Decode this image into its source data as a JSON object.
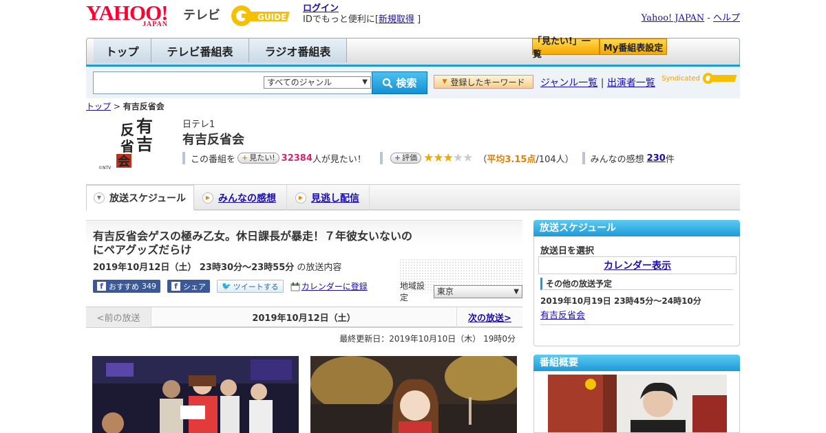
{
  "header": {
    "yahoo_logo": "YAHOO!",
    "yahoo_logo_sub": "JAPAN",
    "tv_label": "テレビ",
    "gguide_logo": "G-GUIDE",
    "login": "ログイン",
    "login_prompt_prefix": "IDでもっと便利に[",
    "signup": "新規取得",
    "login_prompt_suffix": "]",
    "yahoo_japan_link": "Yahoo! JAPAN",
    "link_separator": "-",
    "help_link": "ヘルプ"
  },
  "nav": {
    "tabs": [
      "トップ",
      "テレビ番組表",
      "ラジオ番組表"
    ],
    "mitai_list": "「見たい!」一覧",
    "my_schedule": "My番組表設定"
  },
  "search": {
    "placeholder": "",
    "genre": "すべてのジャンル",
    "button": "検索",
    "keyword_button": "登録したキーワード",
    "genre_list": "ジャンル一覧",
    "separator": "|",
    "performer_list": "出演者一覧",
    "syndicated": "Syndicated"
  },
  "breadcrumb": {
    "top": "トップ",
    "sep": ">",
    "current": "有吉反省会"
  },
  "program": {
    "logo_chars": "有吉反省会",
    "logo_copyright": "©NTV",
    "channel": "日テレ1",
    "title": "有吉反省会",
    "mitai_prefix": "この番組を",
    "mitai_button": "見たい!",
    "mitai_count": "32384",
    "mitai_suffix": "人が見たい！",
    "rating_button": "評価",
    "rating_stars_on": "★★★",
    "rating_stars_off": "★★",
    "rating_open": "（",
    "rating_avg": "平均3.15点",
    "rating_suffix": "/104人）",
    "kanso_prefix": "みんなの感想",
    "kanso_count": "230",
    "kanso_suffix": "件"
  },
  "content_tabs": {
    "schedule": "放送スケジュール",
    "reviews": "みんなの感想",
    "missed": "見逃し配信"
  },
  "episode": {
    "title": "有吉反省会ゲスの極み乙女。休日課長が暴走！７年彼女いないのにペアグッズだらけ",
    "date": "2019年10月12日（土）  23時30分～23時55分",
    "date_suffix": "の放送内容",
    "fb_label": "おすすめ",
    "fb_count": "349",
    "share": "シェア",
    "tweet": "ツイートする",
    "calendar_add": "カレンダーに登録",
    "region_label": "地域設定",
    "region": "東京"
  },
  "pager": {
    "prev": "<前の放送",
    "current": "2019年10月12日（土）",
    "next": "次の放送>"
  },
  "updated": "最終更新日：2019年10月10日（木）  19時0分",
  "sidebar": {
    "schedule_title": "放送スケジュール",
    "date_select": "放送日を選択",
    "calendar": "カレンダー表示",
    "other_title": "その他の放送予定",
    "other_date": "2019年10月19日  23時45分～24時10分",
    "other_link": "有吉反省会",
    "overview_title": "番組概要"
  },
  "colors": {
    "accent_blue": "#1d9ad8",
    "yahoo_red": "#ff0033",
    "count_pink": "#d6246e",
    "star_gold": "#f0a800"
  }
}
